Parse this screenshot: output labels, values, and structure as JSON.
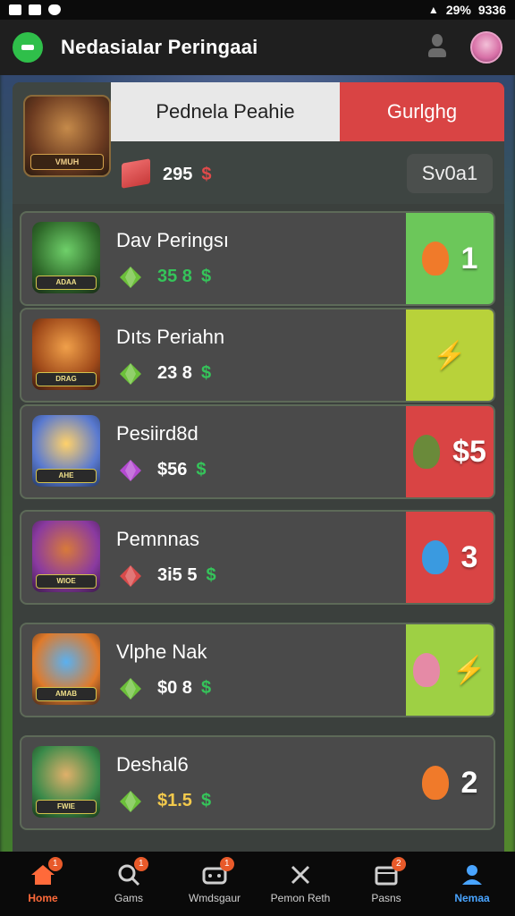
{
  "status_bar": {
    "left_icons": [
      "sim-icon",
      "message-icon",
      "shield-icon"
    ],
    "right_text": "29%",
    "time": "9336"
  },
  "app_bar": {
    "title": "Nedasialar Peringaai"
  },
  "hero": {
    "title": "Pednela Peahie",
    "action_label": "Gurlghg",
    "thumb_tag": "VMUH",
    "price": "295",
    "currency": "$",
    "button_label": "Sv0a1"
  },
  "rows": [
    {
      "name": "Dav Peringsı",
      "price": "35  8",
      "currency": "$",
      "thumb_tag": "ADAA",
      "side": "1",
      "side_color": "#6cc75a",
      "blob_color": "#f07a2a"
    },
    {
      "name": "Dıts Periahn",
      "price": "23  8",
      "currency": "$",
      "thumb_tag": "DRAG",
      "side": "",
      "side_color": "#b8d23a",
      "blob_color": ""
    },
    {
      "name": "Pesiird8d",
      "price": "$56",
      "currency": "$",
      "thumb_tag": "AHE",
      "side": "$5",
      "side_color": "#d94444",
      "blob_color": "#6a8a3a"
    },
    {
      "name": "Pemnnas",
      "price": "3i5 5",
      "currency": "$",
      "thumb_tag": "WIOE",
      "side": "3",
      "side_color": "#d94444",
      "blob_color": "#3a9ae0"
    },
    {
      "name": "Vlphe Nak",
      "price": "$0 8",
      "currency": "$",
      "thumb_tag": "AMAB",
      "side": "",
      "side_color": "#9ed044",
      "blob_color": "#e58aa6"
    },
    {
      "name": "Deshal6",
      "price": "$1.5",
      "currency": "$",
      "thumb_tag": "FWIE",
      "side": "2",
      "side_color": "#4a4a4a",
      "blob_color": "#f07a2a"
    }
  ],
  "bottom_nav": [
    {
      "label": "Home",
      "icon": "home-icon",
      "badge": "1"
    },
    {
      "label": "Gams",
      "icon": "search-icon",
      "badge": "1"
    },
    {
      "label": "Wmdsgaur",
      "icon": "gamepad-icon",
      "badge": "1"
    },
    {
      "label": "Pemon Reth",
      "icon": "tools-icon",
      "badge": ""
    },
    {
      "label": "Pasns",
      "icon": "calendar-icon",
      "badge": "2"
    },
    {
      "label": "Nemaa",
      "icon": "profile-icon",
      "badge": ""
    }
  ]
}
